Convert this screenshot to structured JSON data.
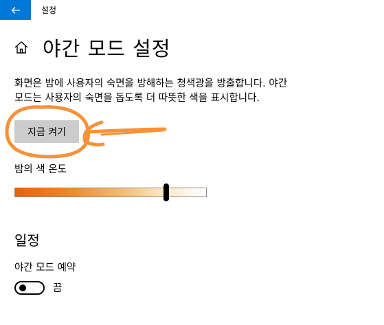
{
  "titlebar": {
    "app_title": "설정",
    "back_icon": "back-arrow-icon",
    "accent_color": "#0078d7"
  },
  "header": {
    "home_icon": "home-icon",
    "title": "야간 모드 설정"
  },
  "main": {
    "description_line1": "화면은 밤에 사용자의 숙면을 방해하는 청색광을 방출합니다. 야간",
    "description_line2": "모드는 사용자의 숙면을 돕도록 더 따뜻한 색을 표시합니다.",
    "turn_on_button": "지금 켜기",
    "color_temperature": {
      "label": "밤의 색 온도",
      "value_fraction": 0.79
    }
  },
  "schedule": {
    "heading": "일정",
    "label": "야간 모드 예약",
    "toggle_state": "끔",
    "toggle_on": false
  },
  "annotation": {
    "color": "#f7923a",
    "icon": "hand-drawn-circle-and-arrow"
  }
}
